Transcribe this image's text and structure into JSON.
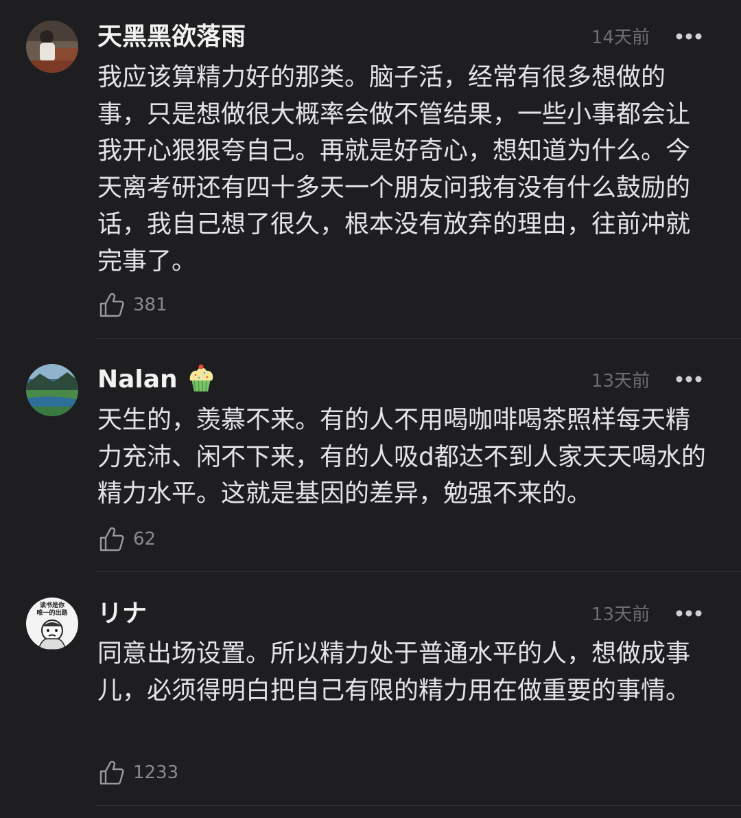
{
  "comments": [
    {
      "username": "天黑黑欲落雨",
      "time": "14天前",
      "text": "我应该算精力好的那类。脑子活，经常有很多想做的事，只是想做很大概率会做不管结果，一些小事都会让我开心狠狠夸自己。再就是好奇心，想知道为什么。今天离考研还有四十多天一个朋友问我有没有什么鼓励的话，我自己想了很久，根本没有放弃的理由，往前冲就完事了。",
      "likes": "381",
      "avatar_icon": "person-photo-avatar"
    },
    {
      "username": "Nalan",
      "badge_icon": "cupcake-icon",
      "time": "13天前",
      "text": "天生的，羡慕不来。有的人不用喝咖啡喝茶照样每天精力充沛、闲不下来，有的人吸d都达不到人家天天喝水的精力水平。这就是基因的差异，勉强不来的。",
      "likes": "62",
      "avatar_icon": "landscape-avatar"
    },
    {
      "username": "リナ",
      "time": "13天前",
      "text": "同意出场设置。所以精力处于普通水平的人，想做成事儿，必须得明白把自己有限的精力用在做重要的事情。",
      "likes": "1233",
      "avatar_icon": "cartoon-meme-avatar",
      "avatar_text": "读书是你唯一的出路"
    }
  ],
  "colors": {
    "background": "#1e1e20",
    "text": "#e4e4e6",
    "muted": "#6e6e73",
    "divider": "#38383c"
  }
}
